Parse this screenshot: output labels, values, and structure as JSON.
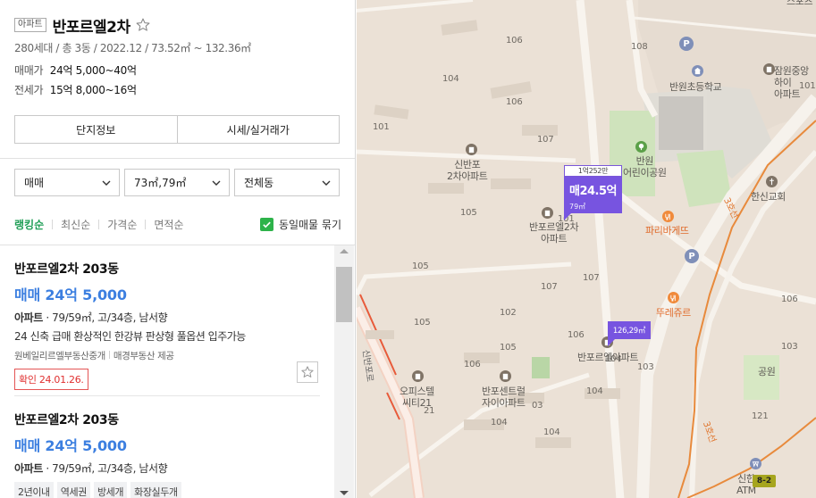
{
  "complex": {
    "type_badge": "아파트",
    "name": "반포르엘2차",
    "meta": "280세대 / 총 3동 / 2022.12 / 73.52㎡ ~ 132.36㎡",
    "sale_label": "매매가",
    "sale_value": "24억 5,000~40억",
    "jeonse_label": "전세가",
    "jeonse_value": "15억 8,000~16억"
  },
  "info_tabs": [
    "단지정보",
    "시세/실거래가"
  ],
  "filters": {
    "trade": "매매",
    "area": "73㎡,79㎡",
    "building": "전체동"
  },
  "sort": {
    "options": [
      "랭킹순",
      "최신순",
      "가격순",
      "면적순"
    ],
    "active": "랭킹순",
    "merge_label": "동일매물 묶기",
    "merge_checked": true
  },
  "listings": [
    {
      "name": "반포르엘2차 203동",
      "price": "매매 24억 5,000",
      "type": "아파트",
      "spec": " · 79/59㎡, 고/34층, 남서향",
      "desc": "24 신축 급매 환상적인 한강뷰 판상형 풀옵션 입주가능",
      "agent": "원베일리르엘부동산중개",
      "provider": "매경부동산 제공",
      "confirm": "확인 24.01.26."
    },
    {
      "name": "반포르엘2차 203동",
      "price": "매매 24억 5,000",
      "type": "아파트",
      "spec": " · 79/59㎡, 고/34층, 남서향",
      "tags": [
        "2년이내",
        "역세권",
        "방세개",
        "화장실두개"
      ]
    }
  ],
  "map": {
    "pin_main": {
      "top": "1억252만",
      "price": "매24.5억",
      "area": "79㎡"
    },
    "pin_small": {
      "area": "126,29㎡"
    },
    "pois": {
      "sinbanpo": "신반포\n2차아파트",
      "banporel2": "반포르엘2차\n아파트",
      "banporel": "반포르엘아파트",
      "banwon_elem": "반원초등학교",
      "banwon_kinder": "반원\n어린이공원",
      "hanshin_church": "한신교회",
      "jamwon_apt": "잠원중앙하이\n아파트",
      "paris": "파리바게뜨",
      "touslesjours": "뚜레쥬르",
      "officetel": "오피스텔\n씨티21",
      "centreville": "반포센트럴\n자이아파트",
      "park": "공원",
      "atm": "신한\nATM",
      "top_right": "스포츠"
    },
    "buildings": [
      "108",
      "106",
      "101",
      "107",
      "104",
      "106",
      "105",
      "107",
      "105",
      "107",
      "102",
      "106",
      "104",
      "103",
      "105",
      "104",
      "106",
      "104",
      "104",
      "105",
      "106",
      "103",
      "101",
      "121",
      "21",
      "101",
      "03"
    ],
    "roads": {
      "line3_a": "3호선",
      "line3_b": "3호선",
      "sinban_ro": "신반포로",
      "exit": "8-2"
    },
    "parking": "P"
  }
}
